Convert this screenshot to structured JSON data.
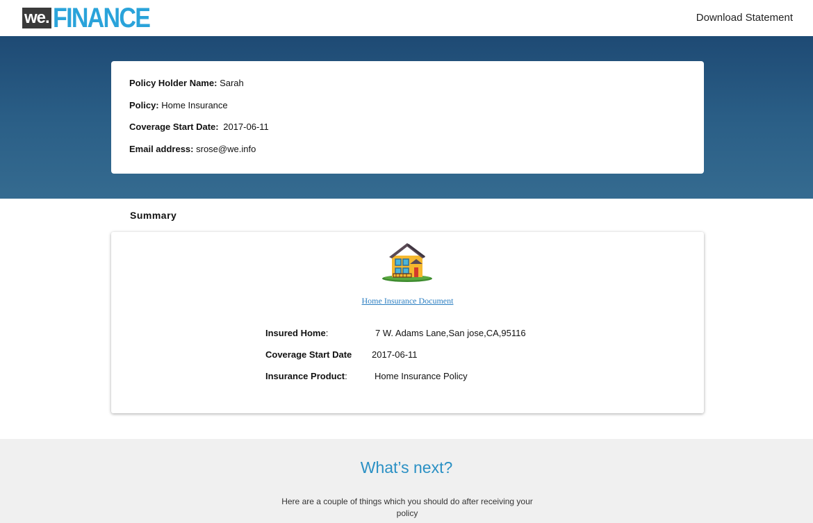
{
  "header": {
    "logo_we": "we.",
    "logo_finance": "FINANCE",
    "download_label": "Download Statement"
  },
  "policy_info": {
    "holder_label": "Policy Holder Name:",
    "holder_value": "Sarah",
    "policy_label": "Policy:",
    "policy_value": "Home Insurance",
    "start_label": "Coverage Start Date:",
    "start_value": "2017-06-11",
    "email_label": "Email address:",
    "email_value": "srose@we.info"
  },
  "summary": {
    "title": "Summary",
    "house_icon": "house-icon",
    "doc_link": "Home Insurance Document",
    "insured_home_label": "Insured Home",
    "insured_home_value": "7 W. Adams Lane,San jose,CA,95116",
    "start_label": "Coverage Start Date",
    "start_value": "2017-06-11",
    "product_label": "Insurance Product",
    "product_value": "Home Insurance Policy"
  },
  "whats_next": {
    "title": "What’s next?",
    "text": "Here are a couple of things which you should do after receiving your policy"
  },
  "colors": {
    "brand_blue": "#2aa3da",
    "hero_top": "#1e4a74",
    "hero_bottom": "#356b90",
    "link": "#2b7ec1"
  }
}
